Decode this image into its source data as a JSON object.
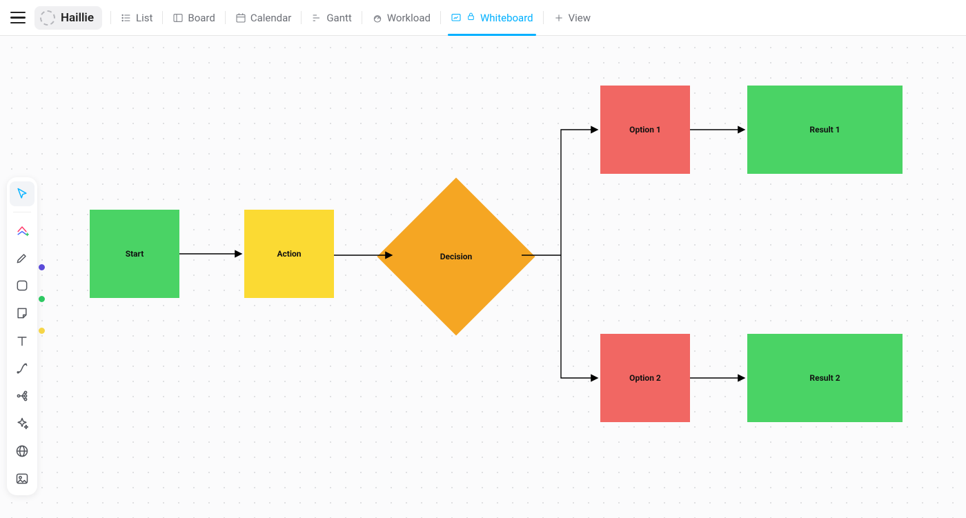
{
  "header": {
    "space_name": "Haillie",
    "tabs": [
      {
        "id": "list",
        "label": "List"
      },
      {
        "id": "board",
        "label": "Board"
      },
      {
        "id": "calendar",
        "label": "Calendar"
      },
      {
        "id": "gantt",
        "label": "Gantt"
      },
      {
        "id": "workload",
        "label": "Workload"
      },
      {
        "id": "whiteboard",
        "label": "Whiteboard",
        "active": true,
        "locked": true
      },
      {
        "id": "addview",
        "label": "View",
        "is_add": true
      }
    ]
  },
  "toolbar": {
    "tools": [
      {
        "id": "pointer",
        "name": "pointer-tool",
        "selected": true
      },
      {
        "id": "clickup",
        "name": "clickup-shapes-tool"
      },
      {
        "id": "pen",
        "name": "pen-tool",
        "dot_color": "#5b4bd9"
      },
      {
        "id": "shape",
        "name": "shape-tool",
        "dot_color": "#2dc862"
      },
      {
        "id": "sticky",
        "name": "sticky-note-tool",
        "dot_color": "#f5d547"
      },
      {
        "id": "text",
        "name": "text-tool"
      },
      {
        "id": "connector",
        "name": "connector-tool"
      },
      {
        "id": "mindmap",
        "name": "mindmap-tool"
      },
      {
        "id": "ai",
        "name": "ai-tool"
      },
      {
        "id": "web",
        "name": "web-embed-tool"
      },
      {
        "id": "image",
        "name": "image-tool"
      }
    ]
  },
  "whiteboard": {
    "nodes": {
      "start": {
        "label": "Start"
      },
      "action": {
        "label": "Action"
      },
      "decision": {
        "label": "Decision"
      },
      "option1": {
        "label": "Option 1"
      },
      "option2": {
        "label": "Option 2"
      },
      "result1": {
        "label": "Result 1"
      },
      "result2": {
        "label": "Result 2"
      }
    }
  },
  "chart_data": {
    "type": "flowchart",
    "nodes": [
      {
        "id": "start",
        "label": "Start",
        "shape": "rect",
        "color": "#4ad365"
      },
      {
        "id": "action",
        "label": "Action",
        "shape": "rect",
        "color": "#fbda33"
      },
      {
        "id": "decision",
        "label": "Decision",
        "shape": "diamond",
        "color": "#f5a623"
      },
      {
        "id": "option1",
        "label": "Option 1",
        "shape": "rect",
        "color": "#f16763"
      },
      {
        "id": "option2",
        "label": "Option 2",
        "shape": "rect",
        "color": "#f16763"
      },
      {
        "id": "result1",
        "label": "Result 1",
        "shape": "rect",
        "color": "#4ad365"
      },
      {
        "id": "result2",
        "label": "Result 2",
        "shape": "rect",
        "color": "#4ad365"
      }
    ],
    "edges": [
      {
        "from": "start",
        "to": "action"
      },
      {
        "from": "action",
        "to": "decision"
      },
      {
        "from": "decision",
        "to": "option1"
      },
      {
        "from": "decision",
        "to": "option2"
      },
      {
        "from": "option1",
        "to": "result1"
      },
      {
        "from": "option2",
        "to": "result2"
      }
    ]
  }
}
